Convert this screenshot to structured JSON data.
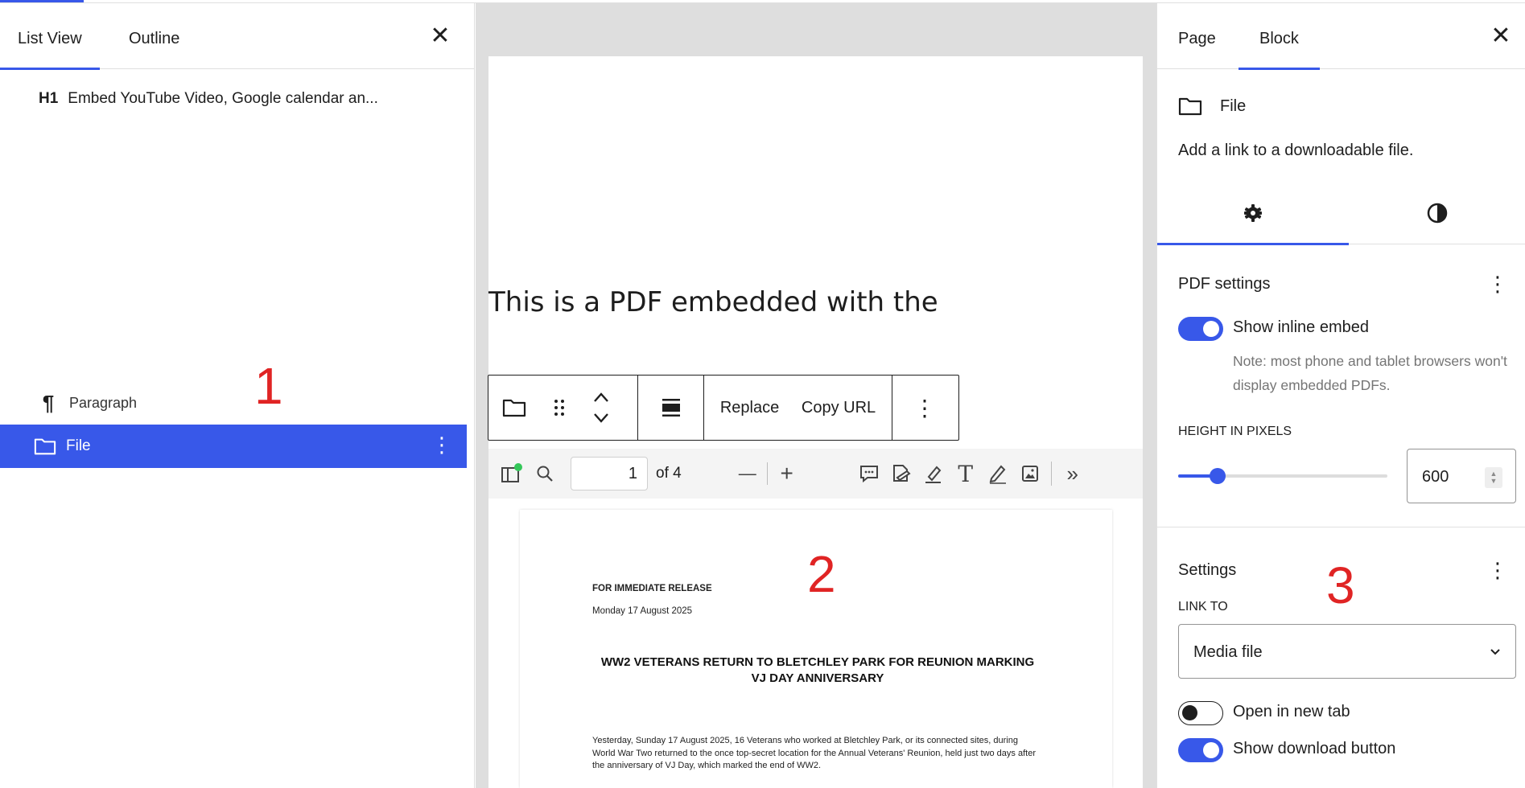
{
  "left_panel": {
    "tabs": [
      "List View",
      "Outline"
    ],
    "close_glyph": "✕",
    "items": [
      {
        "tag": "H1",
        "label": "Embed YouTube Video, Google calendar an..."
      },
      {
        "icon": "paragraph-icon",
        "glyph": "¶",
        "label": "Paragraph"
      },
      {
        "icon": "folder-icon",
        "label": "File",
        "more_glyph": "⋮"
      }
    ],
    "annotation": "1"
  },
  "canvas": {
    "heading_text": "This is a PDF embedded with the",
    "block_toolbar": {
      "replace_label": "Replace",
      "copy_url_label": "Copy URL",
      "more_glyph": "⋮"
    },
    "pdf_toolbar": {
      "page_value": "1",
      "page_total": "of 4",
      "zoom_out_glyph": "—",
      "zoom_in_glyph": "+",
      "text_tool_glyph": "T",
      "more_glyph": "»"
    },
    "pdf_page": {
      "release_label": "FOR IMMEDIATE RELEASE",
      "date": "Monday 17 August 2025",
      "title": "WW2 VETERANS RETURN TO BLETCHLEY PARK FOR REUNION MARKING VJ DAY ANNIVERSARY",
      "body": "Yesterday, Sunday 17 August 2025, 16 Veterans who worked at Bletchley Park, or its connected sites, during World War Two returned to the once top-secret location for the Annual Veterans' Reunion, held just two days after the anniversary of VJ Day, which marked the end of WW2."
    },
    "annotation": "2"
  },
  "right_panel": {
    "tabs": [
      "Page",
      "Block"
    ],
    "close_glyph": "✕",
    "block_name": "File",
    "block_description": "Add a link to a downloadable file.",
    "pdf_settings": {
      "title": "PDF settings",
      "more_glyph": "⋮",
      "show_inline_label": "Show inline embed",
      "show_inline_on": true,
      "note": "Note: most phone and tablet browsers won't display embedded PDFs.",
      "height_label": "HEIGHT IN PIXELS",
      "height_value": "600",
      "height_slider_fraction": 0.19
    },
    "settings": {
      "title": "Settings",
      "more_glyph": "⋮",
      "link_to_label": "LINK TO",
      "link_to_value": "Media file",
      "open_new_tab_label": "Open in new tab",
      "open_new_tab_on": false,
      "show_download_label": "Show download button",
      "show_download_on": true
    },
    "annotation": "3"
  },
  "colors": {
    "accent": "#3858e9",
    "annotation_red": "#e02424",
    "canvas_bg": "#dedede",
    "muted_text": "#757575"
  }
}
